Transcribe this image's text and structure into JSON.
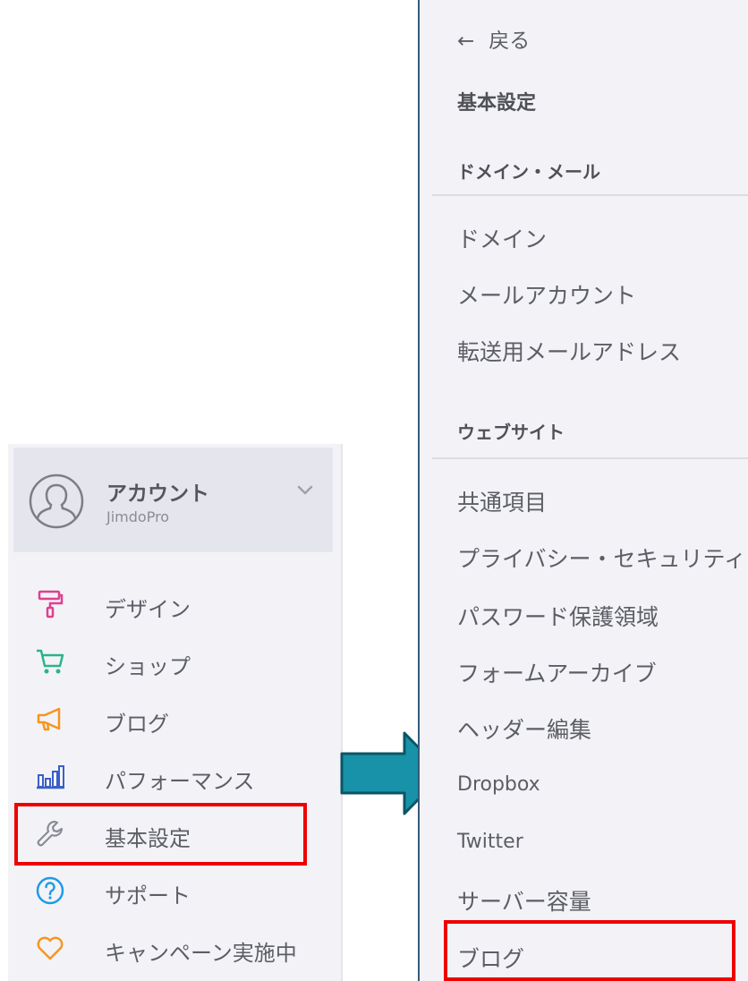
{
  "sidebar": {
    "account": {
      "name": "アカウント",
      "plan": "JimdoPro"
    },
    "items": [
      {
        "label": "デザイン",
        "icon": "paint-roller-icon",
        "color": "#e0408f"
      },
      {
        "label": "ショップ",
        "icon": "cart-icon",
        "color": "#2ab48a"
      },
      {
        "label": "ブログ",
        "icon": "megaphone-icon",
        "color": "#f6951f"
      },
      {
        "label": "パフォーマンス",
        "icon": "bar-chart-icon",
        "color": "#3a5fc8"
      },
      {
        "label": "基本設定",
        "icon": "wrench-icon",
        "color": "#8b8d96"
      },
      {
        "label": "サポート",
        "icon": "question-circle-icon",
        "color": "#1d9be8"
      },
      {
        "label": "キャンペーン実施中",
        "icon": "heart-icon",
        "color": "#f6951f"
      }
    ]
  },
  "panel": {
    "back": {
      "arrow": "←",
      "label": "戻る"
    },
    "title": "基本設定",
    "sections": [
      {
        "heading": "ドメイン・メール",
        "items": [
          "ドメイン",
          "メールアカウント",
          "転送用メールアドレス"
        ]
      },
      {
        "heading": "ウェブサイト",
        "items": [
          "共通項目",
          "プライバシー・セキュリティ",
          "パスワード保護領域",
          "フォームアーカイブ",
          "ヘッダー編集",
          "Dropbox",
          "Twitter",
          "サーバー容量",
          "ブログ"
        ]
      }
    ]
  },
  "colors": {
    "highlight": "#ee0000",
    "arrow_fill": "#1792a8",
    "arrow_stroke": "#0d5466"
  }
}
